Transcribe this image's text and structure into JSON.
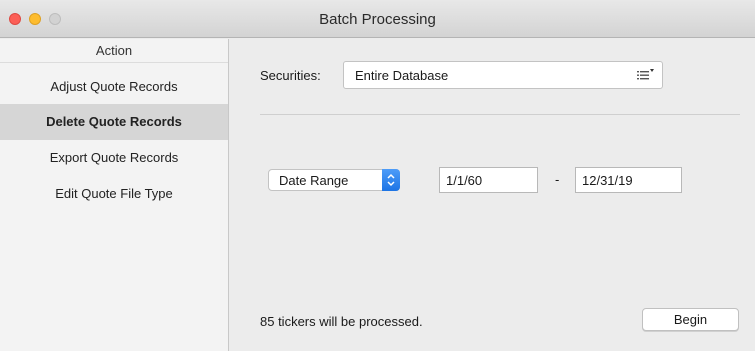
{
  "window": {
    "title": "Batch Processing"
  },
  "sidebar": {
    "header": "Action",
    "items": [
      {
        "label": "Adjust Quote Records",
        "selected": false
      },
      {
        "label": "Delete Quote Records",
        "selected": true
      },
      {
        "label": "Export Quote Records",
        "selected": false
      },
      {
        "label": "Edit Quote File Type",
        "selected": false
      }
    ]
  },
  "main": {
    "securities_label": "Securities:",
    "securities_value": "Entire Database",
    "range_popup_value": "Date Range",
    "start_date": "1/1/60",
    "range_separator": "-",
    "end_date": "12/31/19",
    "status_text": "85 tickers will be processed.",
    "begin_label": "Begin"
  },
  "colors": {
    "close": "#fc5f57",
    "minimize": "#fdbc2e",
    "zoom": "#d2d2d2",
    "accent": "#1d74e5"
  },
  "icons": {
    "securities_menu": "list-menu-icon",
    "popup_arrows": "up-down-chevron-icon"
  }
}
